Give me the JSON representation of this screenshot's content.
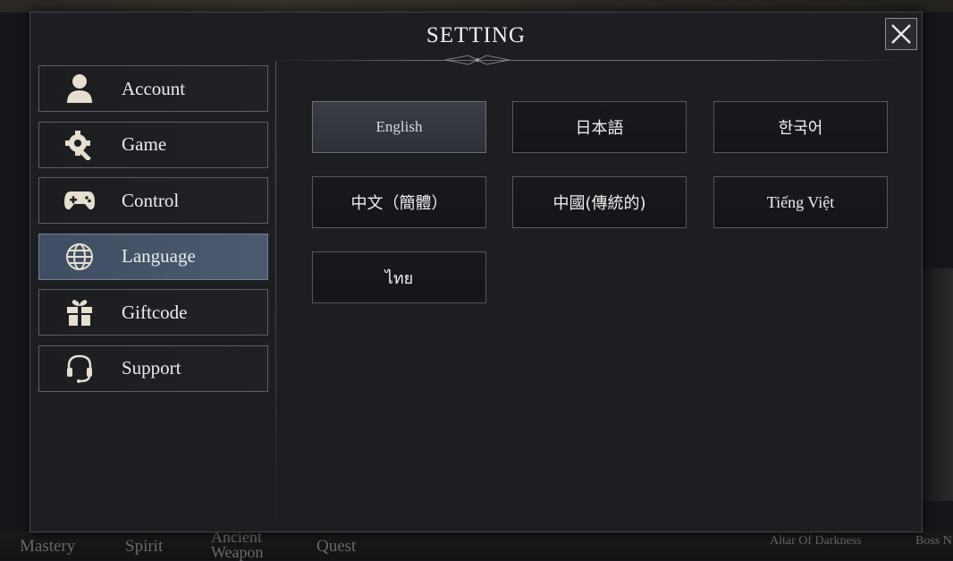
{
  "modal": {
    "title": "SETTING"
  },
  "sidebar": {
    "items": [
      {
        "label": "Account",
        "icon": "person-icon",
        "active": false
      },
      {
        "label": "Game",
        "icon": "gear-wrench-icon",
        "active": false
      },
      {
        "label": "Control",
        "icon": "gamepad-icon",
        "active": false
      },
      {
        "label": "Language",
        "icon": "globe-icon",
        "active": true
      },
      {
        "label": "Giftcode",
        "icon": "gift-icon",
        "active": false
      },
      {
        "label": "Support",
        "icon": "headset-icon",
        "active": false
      }
    ]
  },
  "languages": {
    "selected": "English",
    "options": [
      "English",
      "日本語",
      "한국어",
      "中文（簡體）",
      "中國(傳統的)",
      "Tiếng Việt",
      "ไทย"
    ]
  },
  "background_nav": {
    "items": [
      "Mastery",
      "Spirit",
      "Ancient",
      "Weapon",
      "Quest",
      "Altar Of Darkness",
      "Boss N"
    ]
  },
  "colors": {
    "active_tab": "#4b5a6e",
    "selected_language": "#3a3d44",
    "panel_background": "#1d1e22"
  }
}
